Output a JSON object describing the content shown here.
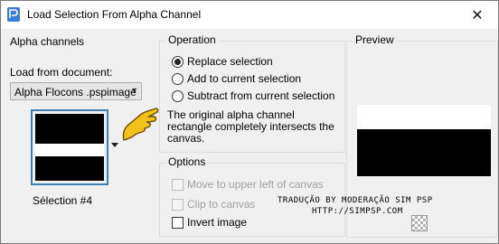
{
  "window": {
    "title": "Load Selection From Alpha Channel",
    "close_glyph": "✕"
  },
  "alpha_channels": {
    "title": "Alpha channels",
    "load_from_label": "Load from document:",
    "document_value": "Alpha Flocons .pspimage",
    "selection_name": "Sélection #4"
  },
  "operation": {
    "title": "Operation",
    "options": [
      {
        "label": "Replace selection",
        "checked": true
      },
      {
        "label": "Add to current selection",
        "checked": false
      },
      {
        "label": "Subtract from current selection",
        "checked": false
      }
    ],
    "description": "The original alpha channel rectangle completely intersects the canvas."
  },
  "options": {
    "title": "Options",
    "move_upper_left": "Move to upper left of canvas",
    "clip_to_canvas": "Clip to canvas",
    "invert_image": "Invert image"
  },
  "preview": {
    "title": "Preview"
  },
  "credit": {
    "line1": "TRADUÇÃO BY MODERAÇÃO SIM PSP",
    "line2": "HTTP://SIMPSP.COM"
  },
  "colors": {
    "accent_border": "#3c7fb1",
    "pointer_yellow": "#f2c21b"
  },
  "icons": [
    "app-icon",
    "close-icon",
    "pointing-hand-icon",
    "dropdown-arrow-icon",
    "checkerboard-icon"
  ]
}
